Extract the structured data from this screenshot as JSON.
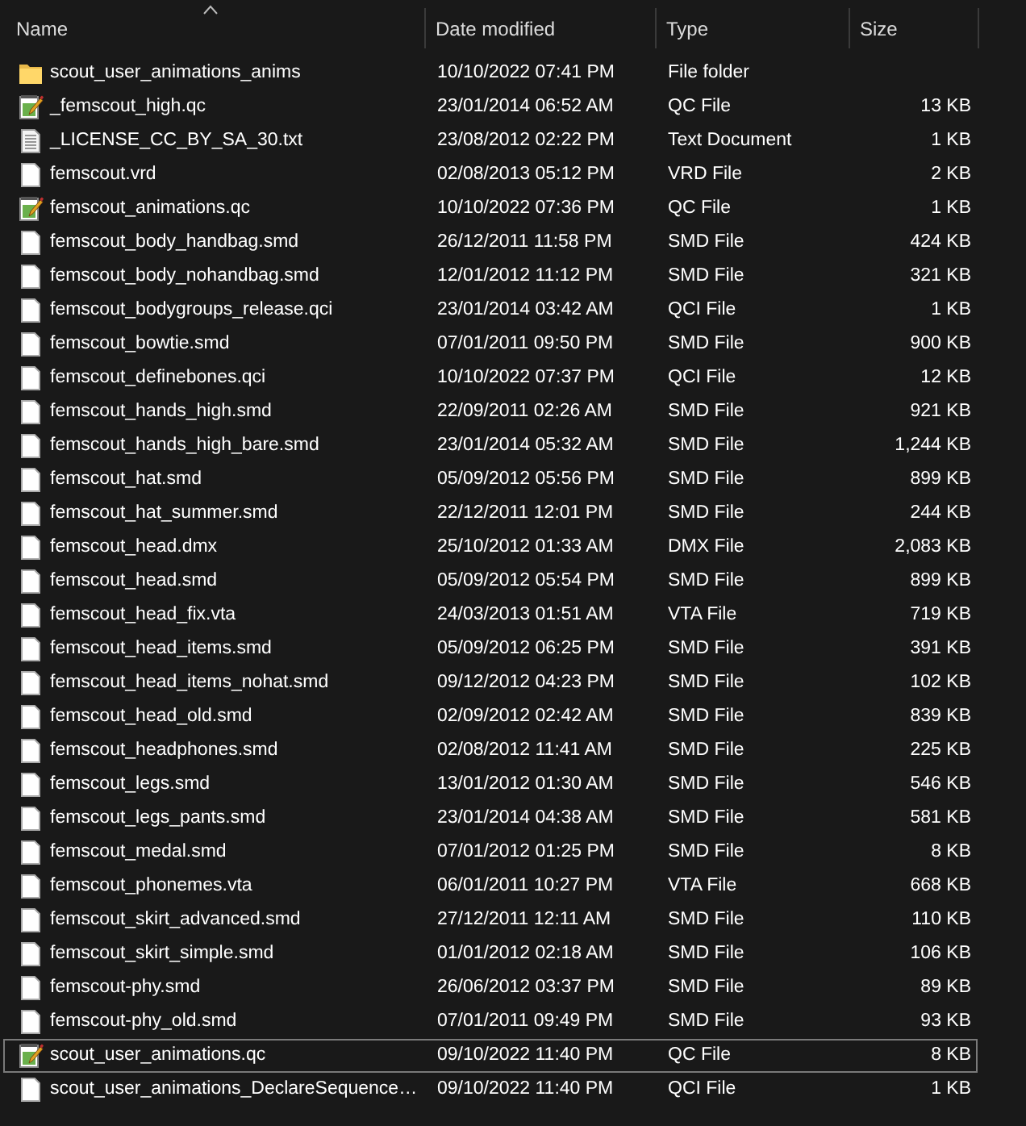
{
  "columns": [
    {
      "label": "Name",
      "sorted": true
    },
    {
      "label": "Date modified",
      "sorted": false
    },
    {
      "label": "Type",
      "sorted": false
    },
    {
      "label": "Size",
      "sorted": false
    }
  ],
  "files": [
    {
      "kind": "folder",
      "name": "scout_user_animations_anims",
      "date": "10/10/2022 07:41 PM",
      "type": "File folder",
      "focused": false
    },
    {
      "kind": "script",
      "name": "_femscout_high.qc",
      "date": "23/01/2014 06:52 AM",
      "type": "QC File",
      "size": "13 KB",
      "focused": false
    },
    {
      "kind": "text",
      "name": "_LICENSE_CC_BY_SA_30.txt",
      "date": "23/08/2012 02:22 PM",
      "type": "Text Document",
      "size": "1 KB",
      "focused": false
    },
    {
      "kind": "file",
      "name": "femscout.vrd",
      "date": "02/08/2013 05:12 PM",
      "type": "VRD File",
      "size": "2 KB",
      "focused": false
    },
    {
      "kind": "script",
      "name": "femscout_animations.qc",
      "date": "10/10/2022 07:36 PM",
      "type": "QC File",
      "size": "1 KB",
      "focused": false
    },
    {
      "kind": "file",
      "name": "femscout_body_handbag.smd",
      "date": "26/12/2011 11:58 PM",
      "type": "SMD File",
      "size": "424 KB",
      "focused": false
    },
    {
      "kind": "file",
      "name": "femscout_body_nohandbag.smd",
      "date": "12/01/2012 11:12 PM",
      "type": "SMD File",
      "size": "321 KB",
      "focused": false
    },
    {
      "kind": "file",
      "name": "femscout_bodygroups_release.qci",
      "date": "23/01/2014 03:42 AM",
      "type": "QCI File",
      "size": "1 KB",
      "focused": false
    },
    {
      "kind": "file",
      "name": "femscout_bowtie.smd",
      "date": "07/01/2011 09:50 PM",
      "type": "SMD File",
      "size": "900 KB",
      "focused": false
    },
    {
      "kind": "file",
      "name": "femscout_definebones.qci",
      "date": "10/10/2022 07:37 PM",
      "type": "QCI File",
      "size": "12 KB",
      "focused": false
    },
    {
      "kind": "file",
      "name": "femscout_hands_high.smd",
      "date": "22/09/2011 02:26 AM",
      "type": "SMD File",
      "size": "921 KB",
      "focused": false
    },
    {
      "kind": "file",
      "name": "femscout_hands_high_bare.smd",
      "date": "23/01/2014 05:32 AM",
      "type": "SMD File",
      "size": "1,244 KB",
      "focused": false
    },
    {
      "kind": "file",
      "name": "femscout_hat.smd",
      "date": "05/09/2012 05:56 PM",
      "type": "SMD File",
      "size": "899 KB",
      "focused": false
    },
    {
      "kind": "file",
      "name": "femscout_hat_summer.smd",
      "date": "22/12/2011 12:01 PM",
      "type": "SMD File",
      "size": "244 KB",
      "focused": false
    },
    {
      "kind": "file",
      "name": "femscout_head.dmx",
      "date": "25/10/2012 01:33 AM",
      "type": "DMX File",
      "size": "2,083 KB",
      "focused": false
    },
    {
      "kind": "file",
      "name": "femscout_head.smd",
      "date": "05/09/2012 05:54 PM",
      "type": "SMD File",
      "size": "899 KB",
      "focused": false
    },
    {
      "kind": "file",
      "name": "femscout_head_fix.vta",
      "date": "24/03/2013 01:51 AM",
      "type": "VTA File",
      "size": "719 KB",
      "focused": false
    },
    {
      "kind": "file",
      "name": "femscout_head_items.smd",
      "date": "05/09/2012 06:25 PM",
      "type": "SMD File",
      "size": "391 KB",
      "focused": false
    },
    {
      "kind": "file",
      "name": "femscout_head_items_nohat.smd",
      "date": "09/12/2012 04:23 PM",
      "type": "SMD File",
      "size": "102 KB",
      "focused": false
    },
    {
      "kind": "file",
      "name": "femscout_head_old.smd",
      "date": "02/09/2012 02:42 AM",
      "type": "SMD File",
      "size": "839 KB",
      "focused": false
    },
    {
      "kind": "file",
      "name": "femscout_headphones.smd",
      "date": "02/08/2012 11:41 AM",
      "type": "SMD File",
      "size": "225 KB",
      "focused": false
    },
    {
      "kind": "file",
      "name": "femscout_legs.smd",
      "date": "13/01/2012 01:30 AM",
      "type": "SMD File",
      "size": "546 KB",
      "focused": false
    },
    {
      "kind": "file",
      "name": "femscout_legs_pants.smd",
      "date": "23/01/2014 04:38 AM",
      "type": "SMD File",
      "size": "581 KB",
      "focused": false
    },
    {
      "kind": "file",
      "name": "femscout_medal.smd",
      "date": "07/01/2012 01:25 PM",
      "type": "SMD File",
      "size": "8 KB",
      "focused": false
    },
    {
      "kind": "file",
      "name": "femscout_phonemes.vta",
      "date": "06/01/2011 10:27 PM",
      "type": "VTA File",
      "size": "668 KB",
      "focused": false
    },
    {
      "kind": "file",
      "name": "femscout_skirt_advanced.smd",
      "date": "27/12/2011 12:11 AM",
      "type": "SMD File",
      "size": "110 KB",
      "focused": false
    },
    {
      "kind": "file",
      "name": "femscout_skirt_simple.smd",
      "date": "01/01/2012 02:18 AM",
      "type": "SMD File",
      "size": "106 KB",
      "focused": false
    },
    {
      "kind": "file",
      "name": "femscout-phy.smd",
      "date": "26/06/2012 03:37 PM",
      "type": "SMD File",
      "size": "89 KB",
      "focused": false
    },
    {
      "kind": "file",
      "name": "femscout-phy_old.smd",
      "date": "07/01/2011 09:49 PM",
      "type": "SMD File",
      "size": "93 KB",
      "focused": false
    },
    {
      "kind": "script",
      "name": "scout_user_animations.qc",
      "date": "09/10/2022 11:40 PM",
      "type": "QC File",
      "size": "8 KB",
      "focused": true
    },
    {
      "kind": "file",
      "name": "scout_user_animations_DeclareSequence…",
      "date": "09/10/2022 11:40 PM",
      "type": "QCI File",
      "size": "1 KB",
      "focused": false
    }
  ]
}
